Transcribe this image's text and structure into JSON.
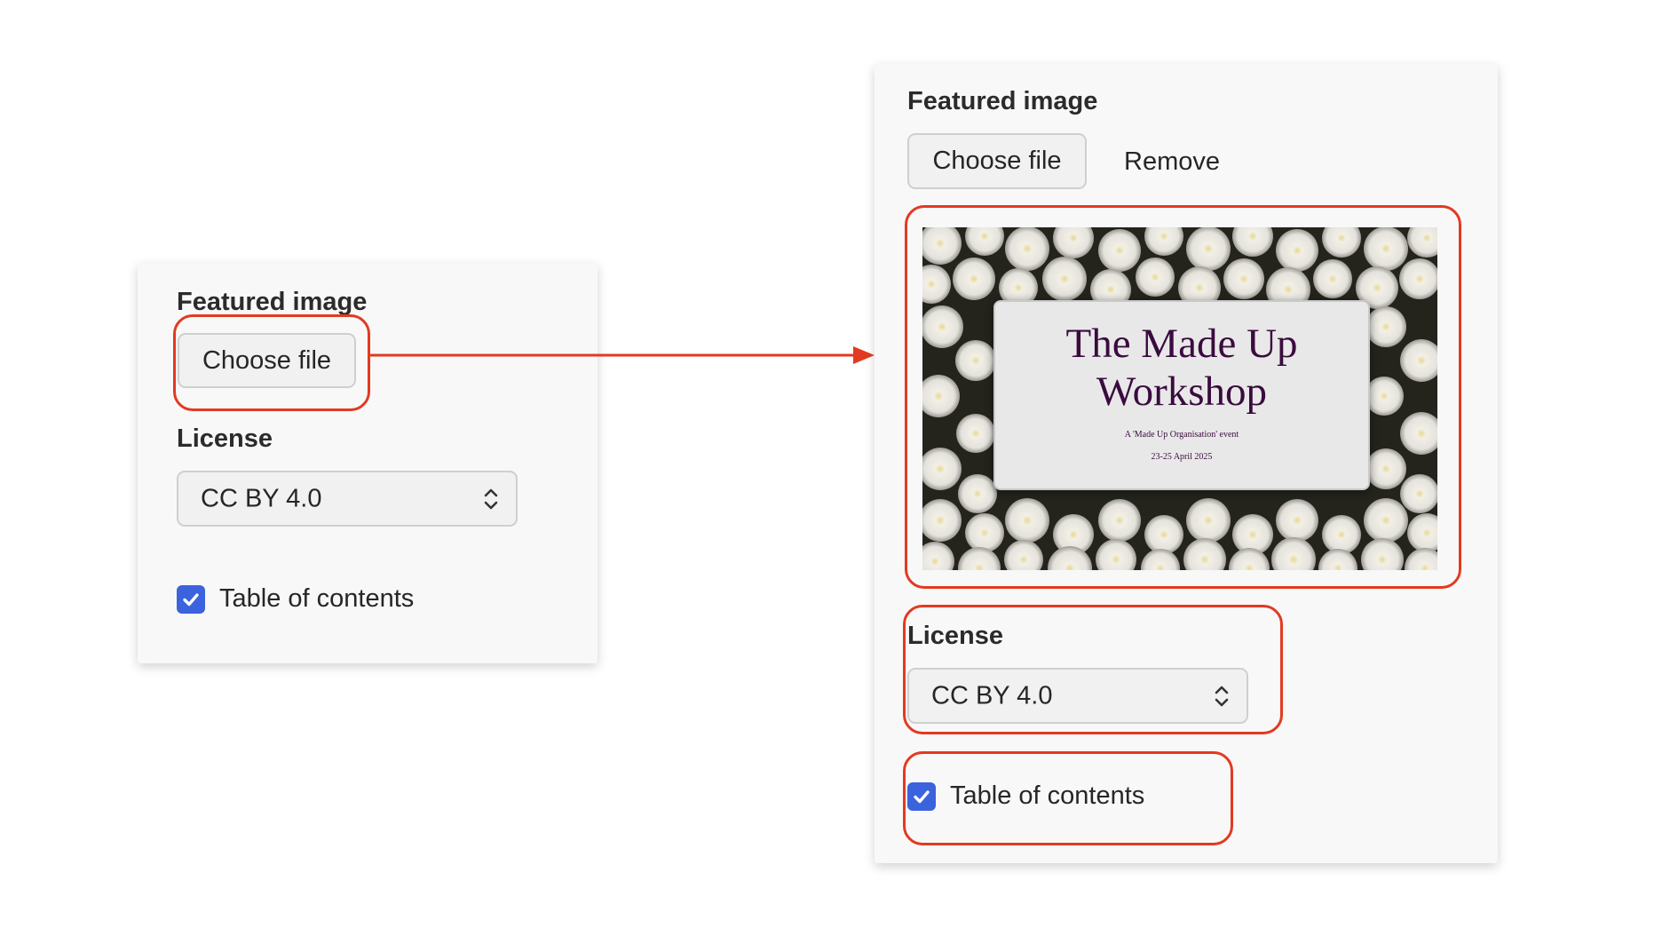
{
  "colors": {
    "highlight": "#e23a21",
    "checkbox_accent": "#3a63dd",
    "panel_bg": "#f8f8f8"
  },
  "left_panel": {
    "featured_image_label": "Featured image",
    "choose_file_label": "Choose file",
    "license_label": "License",
    "license_value": "CC BY 4.0",
    "toc_label": "Table of contents",
    "toc_checked": true
  },
  "right_panel": {
    "featured_image_label": "Featured image",
    "choose_file_label": "Choose file",
    "remove_label": "Remove",
    "preview": {
      "title_line1": "The Made Up",
      "title_line2": "Workshop",
      "subtitle": "A 'Made Up Organisation' event",
      "date": "23-25 April 2025"
    },
    "license_label": "License",
    "license_value": "CC BY 4.0",
    "toc_label": "Table of contents",
    "toc_checked": true
  },
  "icons": {
    "select_chevron": "chevron-up-down-icon",
    "checkmark": "checkmark-icon",
    "arrow": "arrow-right-icon"
  }
}
